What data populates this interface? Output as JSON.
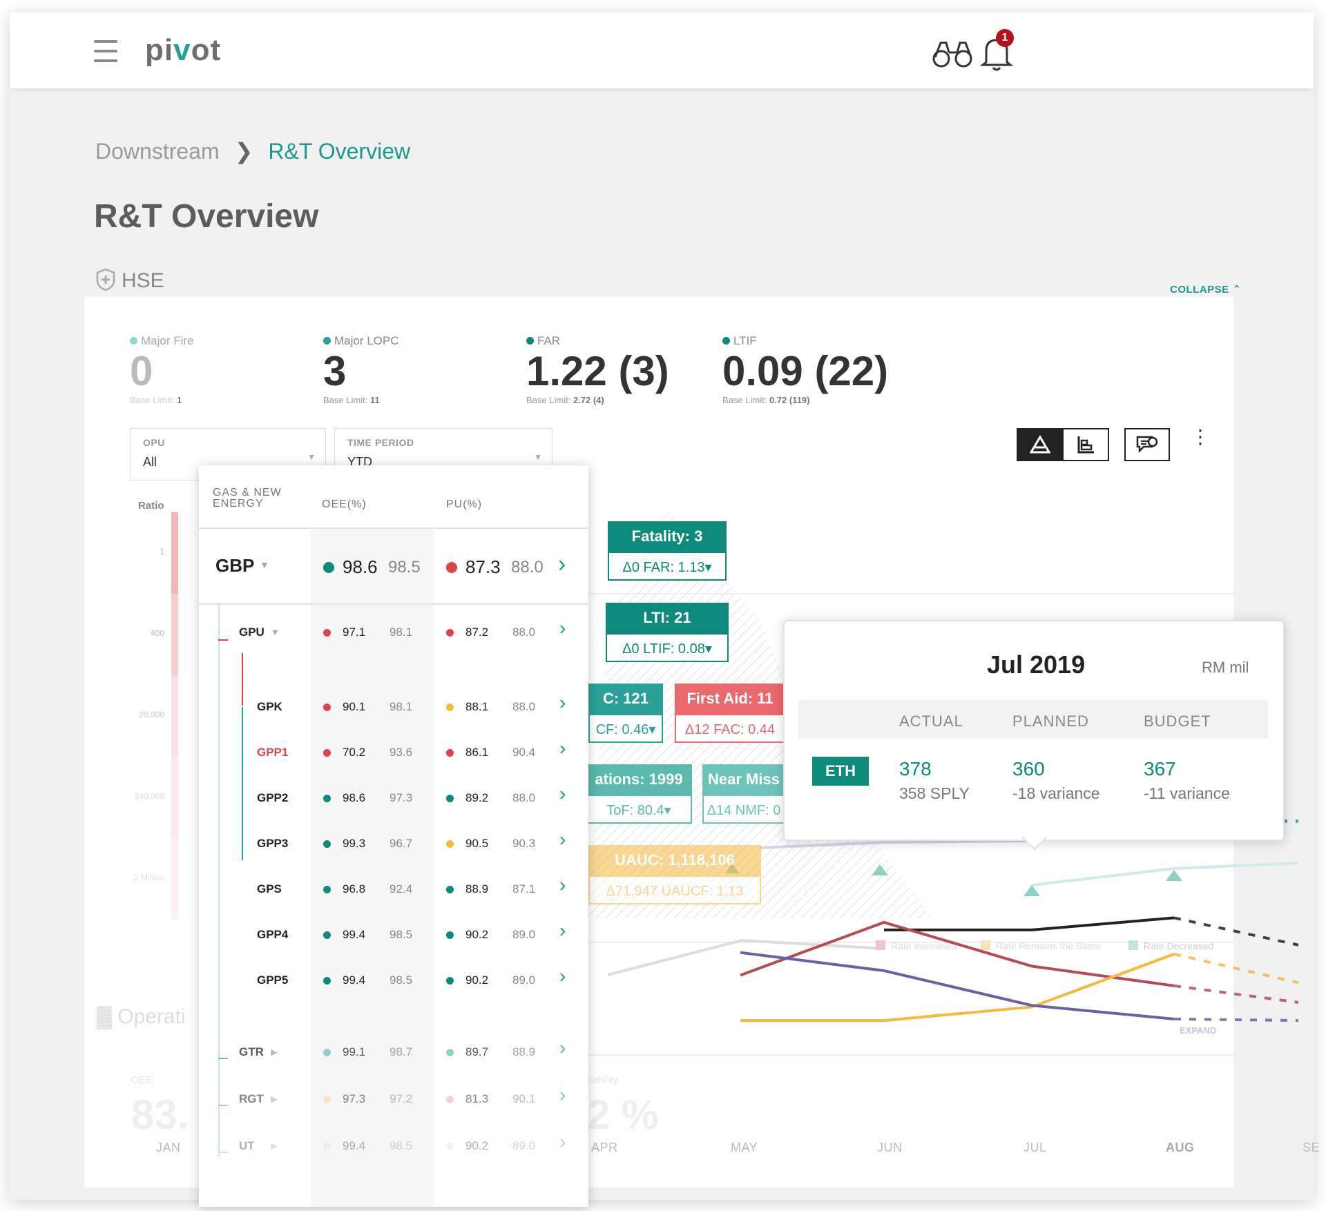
{
  "header": {
    "logo": "pivot",
    "notification_count": "1"
  },
  "breadcrumb": {
    "parent": "Downstream",
    "current": "R&T Overview"
  },
  "page_title": "R&T Overview",
  "section": {
    "title": "HSE",
    "collapse_label": "COLLAPSE"
  },
  "kpis": [
    {
      "label": "Major Fire",
      "value": "0",
      "base_label": "Base Limit:",
      "base_value": "1",
      "color": "#7fd1c5"
    },
    {
      "label": "Major LOPC",
      "value": "3",
      "base_label": "Base Limit:",
      "base_value": "11",
      "color": "#2aa198"
    },
    {
      "label": "FAR",
      "value": "1.22 (3)",
      "base_label": "Base Limit:",
      "base_value": "2.72 (4)",
      "color": "#0e8a7c"
    },
    {
      "label": "LTIF",
      "value": "0.09 (22)",
      "base_label": "Base Limit:",
      "base_value": "0.72 (119)",
      "color": "#0e8a7c"
    }
  ],
  "filters": {
    "opu": {
      "label": "OPU",
      "value": "All"
    },
    "period": {
      "label": "TIME PERIOD",
      "value": "YTD"
    }
  },
  "side_axis": {
    "title": "Ratio",
    "ticks": [
      "1",
      "400",
      "20,000",
      "240,000",
      "2 Million"
    ]
  },
  "table": {
    "headers": {
      "group": "GAS & NEW ENERGY",
      "oee": "OEE(%)",
      "pu": "PU(%)"
    },
    "top": {
      "name": "GBP",
      "oee": "98.6",
      "oee_plan": "98.5",
      "pu": "87.3",
      "pu_plan": "88.0"
    },
    "rows": [
      {
        "name": "GPU",
        "oee": "97.1",
        "oee_plan": "98.1",
        "pu": "87.2",
        "pu_plan": "88.0",
        "oee_color": "#e0444b",
        "pu_color": "#e0444b"
      },
      {
        "name": "GPK",
        "oee": "90.1",
        "oee_plan": "98.1",
        "pu": "88.1",
        "pu_plan": "88.0",
        "oee_color": "#e0444b",
        "pu_color": "#f6b93b"
      },
      {
        "name": "GPP1",
        "oee": "70.2",
        "oee_plan": "93.6",
        "pu": "86.1",
        "pu_plan": "90.4",
        "oee_color": "#e0444b",
        "pu_color": "#e0444b"
      },
      {
        "name": "GPP2",
        "oee": "98.6",
        "oee_plan": "97.3",
        "pu": "89.2",
        "pu_plan": "88.0",
        "oee_color": "#0e8a7c",
        "pu_color": "#0e8a7c"
      },
      {
        "name": "GPP3",
        "oee": "99.3",
        "oee_plan": "96.7",
        "pu": "90.5",
        "pu_plan": "90.3",
        "oee_color": "#0e8a7c",
        "pu_color": "#f6b93b"
      },
      {
        "name": "GPS",
        "oee": "96.8",
        "oee_plan": "92.4",
        "pu": "88.9",
        "pu_plan": "87.1",
        "oee_color": "#0e8a7c",
        "pu_color": "#0e8a7c"
      },
      {
        "name": "GPP4",
        "oee": "99.4",
        "oee_plan": "98.5",
        "pu": "90.2",
        "pu_plan": "89.0",
        "oee_color": "#0e8a7c",
        "pu_color": "#0e8a7c"
      },
      {
        "name": "GPP5",
        "oee": "99.4",
        "oee_plan": "98.5",
        "pu": "90.2",
        "pu_plan": "89.0",
        "oee_color": "#0e8a7c",
        "pu_color": "#0e8a7c"
      },
      {
        "name": "GTR",
        "oee": "99.1",
        "oee_plan": "98.7",
        "pu": "89.7",
        "pu_plan": "88.9",
        "oee_color": "#6cc3b8",
        "pu_color": "#6cc3b8"
      },
      {
        "name": "RGT",
        "oee": "97.3",
        "oee_plan": "97.2",
        "pu": "81.3",
        "pu_plan": "90.1",
        "oee_color": "#f8d8a0",
        "pu_color": "#eeb0b2"
      },
      {
        "name": "UT",
        "oee": "99.4",
        "oee_plan": "98.5",
        "pu": "90.2",
        "pu_plan": "89.0",
        "oee_color": "#c6e8e4",
        "pu_color": "#c6e8e4"
      }
    ]
  },
  "tags": {
    "fatality": {
      "title": "Fatality: 3",
      "sub": "Δ0  FAR: 1.13▾"
    },
    "lti": {
      "title": "LTI: 21",
      "sub": "Δ0  LTIF: 0.08▾"
    },
    "c121": {
      "title": "C: 121",
      "sub": "CF: 0.46▾"
    },
    "first_aid": {
      "title": "First Aid: 11",
      "sub": "Δ12  FAC: 0.44"
    },
    "observations": {
      "title": "ations: 1999",
      "sub": "ToF: 80.4▾"
    },
    "near_miss": {
      "title": "Near Miss",
      "sub": "Δ14  NMF: 0"
    },
    "uauc": {
      "title": "UAUC: 1,118,106",
      "sub": "Δ71,947  UAUCF: 1.13"
    }
  },
  "legend": {
    "increased": "Rate Increased",
    "same": "Rate Remains the Same",
    "decreased": "Rate Decreased"
  },
  "faded": {
    "operations": "Operati",
    "oee_label": "OEE",
    "oee_value": "83.",
    "avail_label": "ilability",
    "avail_value": "2 %",
    "expand": "EXPAND"
  },
  "months": [
    "JAN",
    "APR",
    "MAY",
    "JUN",
    "JUL",
    "AUG",
    "SE"
  ],
  "popup": {
    "title": "Jul 2019",
    "unit": "RM mil",
    "headers": [
      "ACTUAL",
      "PLANNED",
      "BUDGET"
    ],
    "badge": "ETH",
    "actual": "378",
    "actual_sub": "358 SPLY",
    "planned": "360",
    "planned_sub": "-18 variance",
    "budget": "367",
    "budget_sub": "-11 variance"
  },
  "chart_data": {
    "type": "line",
    "categories": [
      "APR",
      "MAY",
      "JUN",
      "JUL",
      "AUG",
      "SE"
    ],
    "series": [
      {
        "color": "#2a9d8f",
        "values": [
          null,
          376,
          371,
          378,
          372,
          372
        ]
      },
      {
        "color": "#222222",
        "values": [
          null,
          null,
          300,
          300,
          308,
          290
        ]
      },
      {
        "color": "#b84a55",
        "values": [
          null,
          270,
          305,
          276,
          263,
          252
        ]
      },
      {
        "color": "#f6b93b",
        "values": [
          null,
          240,
          240,
          249,
          284,
          265
        ]
      },
      {
        "color": "#6b5fa8",
        "values": [
          null,
          285,
          273,
          250,
          241,
          240
        ]
      }
    ]
  }
}
